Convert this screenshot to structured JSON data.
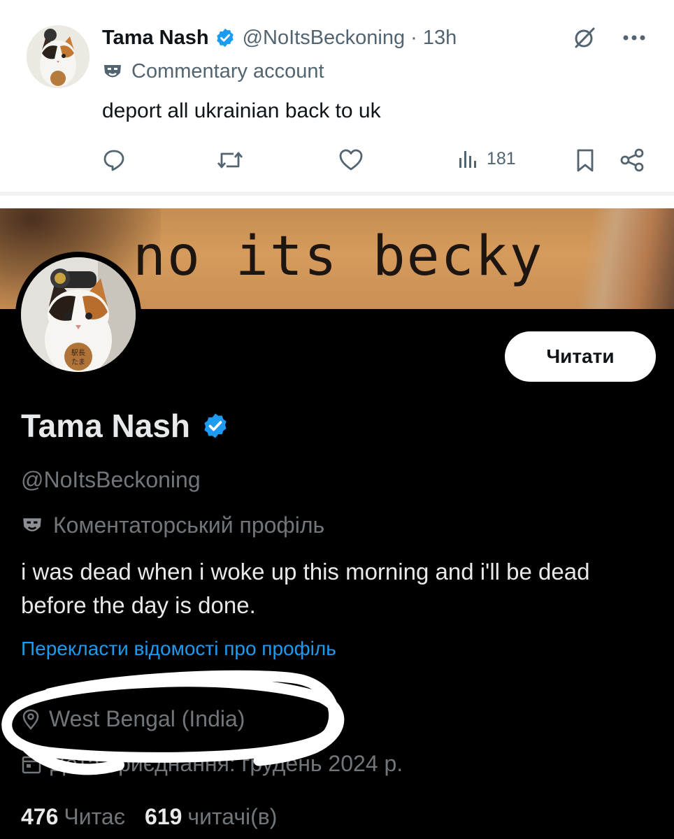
{
  "tweet": {
    "author_name": "Tama Nash",
    "handle": "@NoItsBeckoning",
    "separator": "·",
    "time": "13h",
    "label": "Commentary account",
    "text": "deport all ukrainian back to uk",
    "views": "181",
    "icons": [
      "grok-icon",
      "more-icon",
      "reply-icon",
      "retweet-icon",
      "like-icon",
      "views-icon",
      "bookmark-icon",
      "share-icon",
      "verified-badge-icon",
      "commentary-label-icon"
    ]
  },
  "profile": {
    "banner_text": "no its becky",
    "follow_label": "Читати",
    "name": "Tama Nash",
    "handle": "@NoItsBeckoning",
    "label": "Коментаторський профіль",
    "bio": "i was dead when i woke up this morning and i'll be dead before the day is done.",
    "translate_link": "Перекласти відомості про профіль",
    "location": "West Bengal (India)",
    "joined": "Дата приєднання: грудень 2024 р.",
    "following_count": "476",
    "following_label": "Читає",
    "followers_count": "619",
    "followers_label": "читачі(в)",
    "colors": {
      "link": "#1d9bf0",
      "verified": "#1d9bf0",
      "muted": "#71767b",
      "background": "#000000"
    }
  }
}
